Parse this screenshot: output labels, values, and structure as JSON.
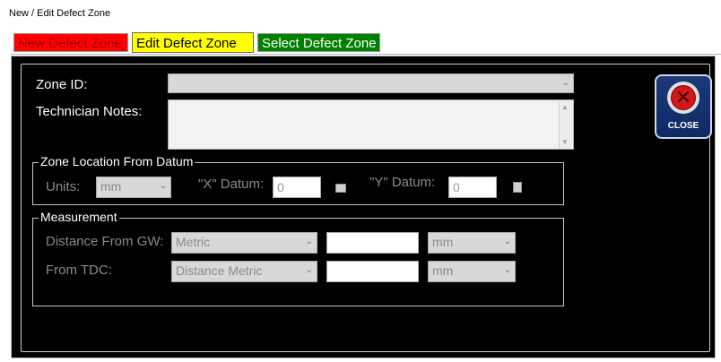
{
  "window": {
    "title": "New / Edit Defect Zone"
  },
  "tabs": [
    {
      "label": "New Defect Zone",
      "color": "#ff0000"
    },
    {
      "label": "Edit Defect Zone",
      "color": "#ffff00"
    },
    {
      "label": "Select Defect Zone",
      "color": "#008000"
    }
  ],
  "form": {
    "zone_id_label": "Zone ID:",
    "zone_id_value": "",
    "notes_label": "Technician Notes:",
    "notes_value": ""
  },
  "location": {
    "legend": "Zone Location From Datum",
    "units_label": "Units:",
    "units_value": "mm",
    "x_label": "\"X\" Datum:",
    "x_value": "0",
    "y_label": "\"Y\" Datum:",
    "y_value": "0"
  },
  "measurement": {
    "legend": "Measurement",
    "rows": [
      {
        "label": "Distance From GW:",
        "type_value": "Metric",
        "amount_value": "",
        "unit_value": "mm"
      },
      {
        "label": "From TDC:",
        "type_value": "Distance Metric",
        "amount_value": "",
        "unit_value": "mm"
      }
    ]
  },
  "close_button": {
    "label": "CLOSE",
    "icon": "close-icon"
  }
}
